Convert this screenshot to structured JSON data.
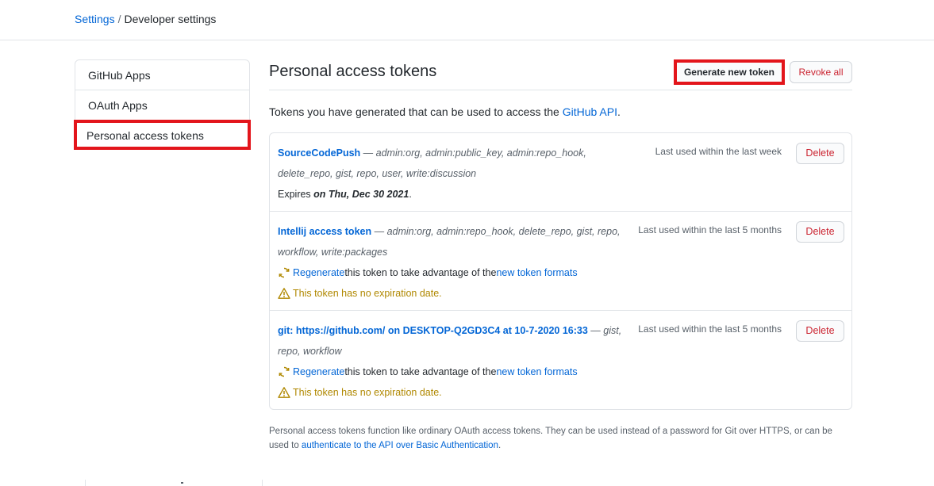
{
  "breadcrumb": {
    "settings": "Settings",
    "separator": "/",
    "current": "Developer settings"
  },
  "sidebar": {
    "items": [
      {
        "label": "GitHub Apps"
      },
      {
        "label": "OAuth Apps"
      },
      {
        "label": "Personal access tokens",
        "active": true
      }
    ]
  },
  "main": {
    "title": "Personal access tokens",
    "generate_label": "Generate new token",
    "revoke_label": "Revoke all",
    "intro_prefix": "Tokens you have generated that can be used to access the ",
    "intro_link": "GitHub API",
    "intro_suffix": "."
  },
  "tokens": [
    {
      "name": "SourceCodePush",
      "dash": " — ",
      "scopes": "admin:org, admin:public_key, admin:repo_hook, delete_repo, gist, repo, user, write:discussion",
      "last_used": "Last used within the last week",
      "expires_prefix": "Expires ",
      "expires_date": "on Thu, Dec 30 2021",
      "expires_suffix": ".",
      "delete_label": "Delete"
    },
    {
      "name": "Intellij access token",
      "dash": " — ",
      "scopes": "admin:org, admin:repo_hook, delete_repo, gist, repo, workflow, write:packages",
      "last_used": "Last used within the last 5 months",
      "regenerate_link": "Regenerate",
      "regenerate_text": " this token to take advantage of the ",
      "formats_link": "new token formats",
      "warning": "This token has no expiration date.",
      "delete_label": "Delete"
    },
    {
      "name": "git: https://github.com/ on DESKTOP-Q2GD3C4 at 10-7-2020 16:33",
      "dash": " — ",
      "scopes": "gist, repo, workflow",
      "last_used": "Last used within the last 5 months",
      "regenerate_link": "Regenerate",
      "regenerate_text": " this token to take advantage of the ",
      "formats_link": "new token formats",
      "warning": "This token has no expiration date.",
      "delete_label": "Delete"
    }
  ],
  "footer": {
    "text": "Personal access tokens function like ordinary OAuth access tokens. They can be used instead of a password for Git over HTTPS, or can be used to ",
    "link": "authenticate to the API over Basic Authentication",
    "suffix": "."
  },
  "colors": {
    "link": "#0366d6",
    "danger": "#cb2431",
    "warning": "#b08800",
    "highlight": "#e3151b"
  },
  "icons": {
    "regenerate": "sync-icon",
    "warning": "alert-icon"
  }
}
